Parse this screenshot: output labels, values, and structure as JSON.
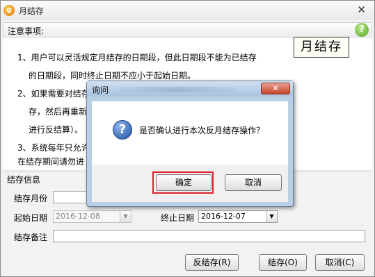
{
  "window": {
    "title": "月结存",
    "app_icon": "app-logo-icon",
    "close_glyph": "✕"
  },
  "notes": {
    "header": "注意事项:",
    "help_glyph": "?",
    "stamp_text": "月结存",
    "lines": [
      "1、用户可以灵活规定月结存的日期段，但此日期段不能为已结存",
      "的日期段，同时终止日期不应小于起始日期。",
      "2、如果需要对结存",
      "存，然后再重新",
      "进行反结算）。",
      "3、系统每年只允许",
      "在结存期间请勿进"
    ]
  },
  "form": {
    "section_title": "结存信息",
    "month_label": "结存月份",
    "month_value": "",
    "start_label": "起始日期",
    "start_value": "2016-12-08",
    "end_label": "终止日期",
    "end_value": "2016-12-07",
    "remark_label": "结存备注",
    "remark_value": ""
  },
  "buttons": {
    "reverse": "反结存(R)",
    "save": "结存(O)",
    "cancel": "取消(C)"
  },
  "dialog": {
    "title": "询问",
    "close_glyph": "✕",
    "icon": "question-icon",
    "icon_glyph": "?",
    "message": "是否确认进行本次反月结存操作？",
    "ok": "确定",
    "cancel": "取消"
  },
  "colors": {
    "highlight_border": "#e0202a",
    "dialog_frame": "#b8cfe6"
  }
}
